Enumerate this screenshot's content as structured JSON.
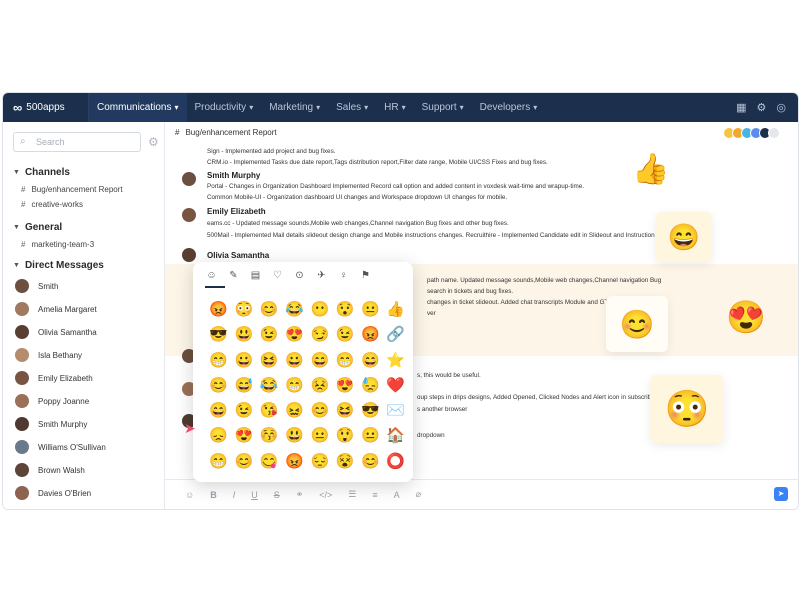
{
  "app": {
    "brand": "500apps"
  },
  "nav": [
    {
      "label": "Communications",
      "active": true
    },
    {
      "label": "Productivity"
    },
    {
      "label": "Marketing"
    },
    {
      "label": "Sales"
    },
    {
      "label": "HR"
    },
    {
      "label": "Support"
    },
    {
      "label": "Developers"
    }
  ],
  "sidebar": {
    "search_placeholder": "Search",
    "channels_title": "Channels",
    "channels": [
      "Bug/enhancement Report",
      "creative-works"
    ],
    "general_title": "General",
    "general": [
      "marketing-team-3"
    ],
    "dm_title": "Direct Messages",
    "dms": [
      "Smith",
      "Amelia Margaret",
      "Olivia Samantha",
      "Isla Bethany",
      "Emily Elizabeth",
      "Poppy Joanne",
      "Smith Murphy",
      "Williams O'Sullivan",
      "Brown Walsh",
      "Davies O'Brien"
    ]
  },
  "channel": {
    "name": "Bug/enhancement Report"
  },
  "messages": {
    "top_lines": [
      "Sign - Implemented add project and bug fixes.",
      "CRM.io - Implemented Tasks due date report,Tags distribution report,Filter date range, Mobile UI/CSS Fixes and bug fixes."
    ],
    "smith_murphy": {
      "author": "Smith Murphy",
      "lines": [
        "Portal - Changes in Organization Dashboard Implemented Record call option and added content in voxdesk wait-time and wrapup-time.",
        "Common Mobile-UI - Organization dashboard UI changes and Workspace dropdown UI changes for mobile."
      ]
    },
    "emily": {
      "author": "Emily Elizabeth",
      "lines": [
        "eams.cc - Updated message sounds,Mobile web changes,Channel navigation Bug fixes and other bug fixes.",
        "500Mail - Implemented Mail details slideout design change and Mobile instructions changes. Recruithire - Implemented Candidate edit in Slideout and Instruction ch"
      ]
    },
    "olivia": {
      "author": "Olivia Samantha",
      "lines": [
        "path name. Updated message sounds,Mobile web changes,Channel navigation Bug",
        "search in tickets and bug fixes.",
        "changes in ticket slideout. Added chat transcripts Module and GTM inst",
        "ver"
      ]
    },
    "lower_lines": [
      "s, this would be useful.",
      "oup steps in drips designs, Added Opened, Clicked Nodes and Alert icon in subscriberlis",
      "s another browser",
      "dropdown"
    ]
  },
  "picker": {
    "tabs": [
      "☺",
      "✎",
      "▤",
      "♡",
      "⊙",
      "✈",
      "♀",
      "⚑"
    ],
    "emojis": [
      "😡",
      "😳",
      "😊",
      "😂",
      "😶",
      "😯",
      "😐",
      "👍",
      "😎",
      "😃",
      "😉",
      "😍",
      "😏",
      "😉",
      "😡",
      "🔗",
      "😁",
      "😀",
      "😆",
      "😀",
      "😄",
      "😁",
      "😄",
      "⭐",
      "😊",
      "😅",
      "😂",
      "😁",
      "😣",
      "😍",
      "😓",
      "❤️",
      "😄",
      "😉",
      "😘",
      "😖",
      "😊",
      "😆",
      "😎",
      "✉️",
      "😞",
      "😍",
      "😚",
      "😃",
      "😐",
      "😲",
      "😐",
      "🏠",
      "😁",
      "😊",
      "😋",
      "😡",
      "😔",
      "😵",
      "😊",
      "⭕"
    ]
  },
  "decorations": [
    "👍",
    "😊",
    "😍",
    "😄",
    "😳"
  ],
  "colors": {
    "nav_bg": "#1c2f4d",
    "accent": "#3b82f6",
    "highlight": "#fdf6e8"
  }
}
